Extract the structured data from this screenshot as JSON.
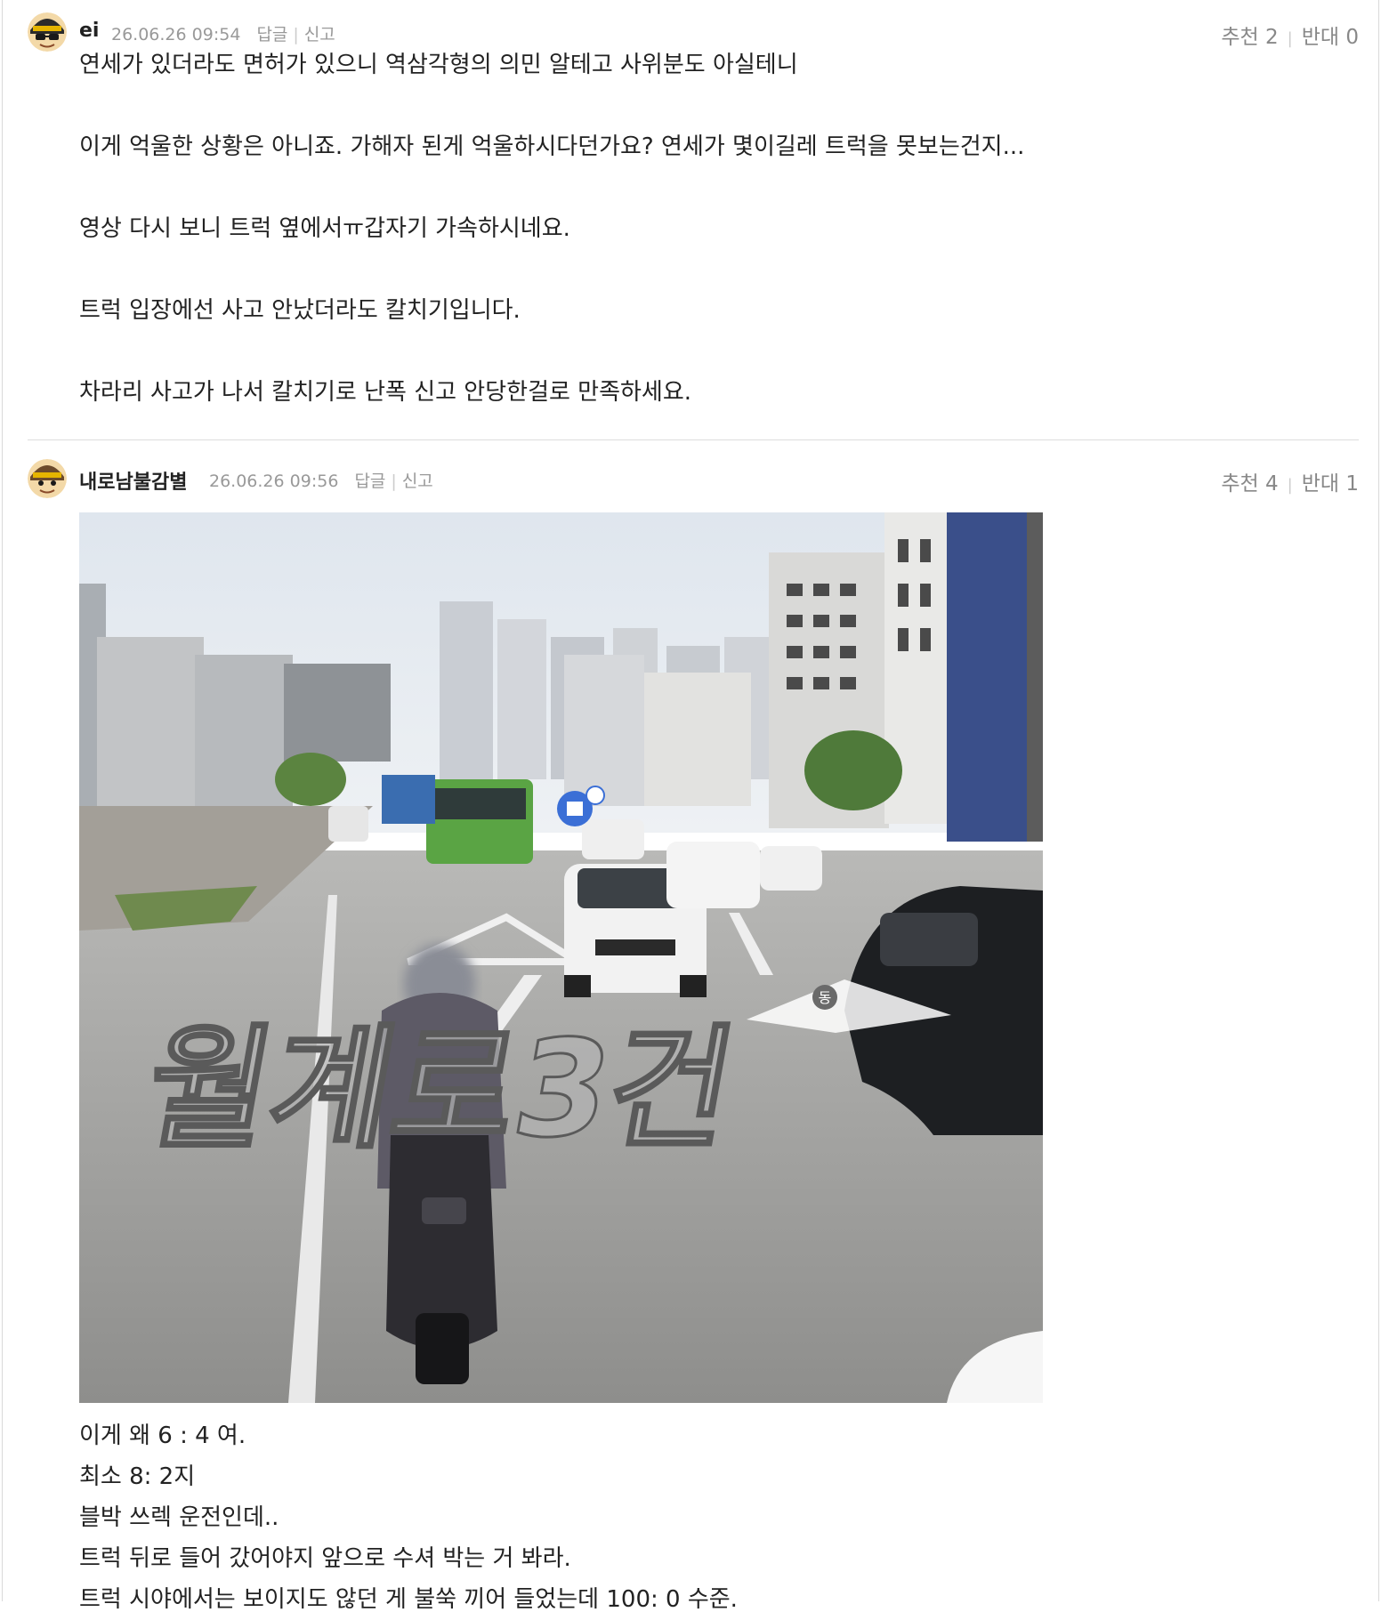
{
  "comments": [
    {
      "nickname": "ei",
      "date": "26.06.26 09:54",
      "reply_label": "답글",
      "report_label": "신고",
      "recommend_label": "추천",
      "recommend_count": "2",
      "oppose_label": "반대",
      "oppose_count": "0",
      "lines": [
        "연세가 있더라도 면허가 있으니 역삼각형의 의민 알테고 사위분도 아실테니",
        "이게 억울한 상황은 아니죠. 가해자 된게 억울하시다던가요? 연세가 몇이길레 트럭을 못보는건지...",
        "영상 다시 보니 트럭 옆에서ㅠ갑자기 가속하시네요.",
        "트럭 입장에선 사고 안났더라도 칼치기입니다.",
        "차라리 사고가 나서 칼치기로 난폭 신고 안당한걸로 만족하세요."
      ]
    },
    {
      "nickname": "내로남불감별",
      "date": "26.06.26 09:56",
      "reply_label": "답글",
      "report_label": "신고",
      "recommend_label": "추천",
      "recommend_count": "4",
      "oppose_label": "반대",
      "oppose_count": "1",
      "photo": {
        "watermark": "월계로3건",
        "road_sign_text": "동"
      },
      "lines": [
        "이게 왜 6 : 4 여.",
        "최소 8: 2지",
        "블박 쓰렉 운전인데..",
        "트럭 뒤로 들어 갔어야지 앞으로 수셔 박는 거 봐라.",
        "트럭 시야에서는 보이지도 않던 게 불쑥 끼어 들었는데 100: 0 수준."
      ]
    }
  ],
  "colors": {
    "text": "#222222",
    "meta": "#999999",
    "divider": "#dddddd"
  }
}
